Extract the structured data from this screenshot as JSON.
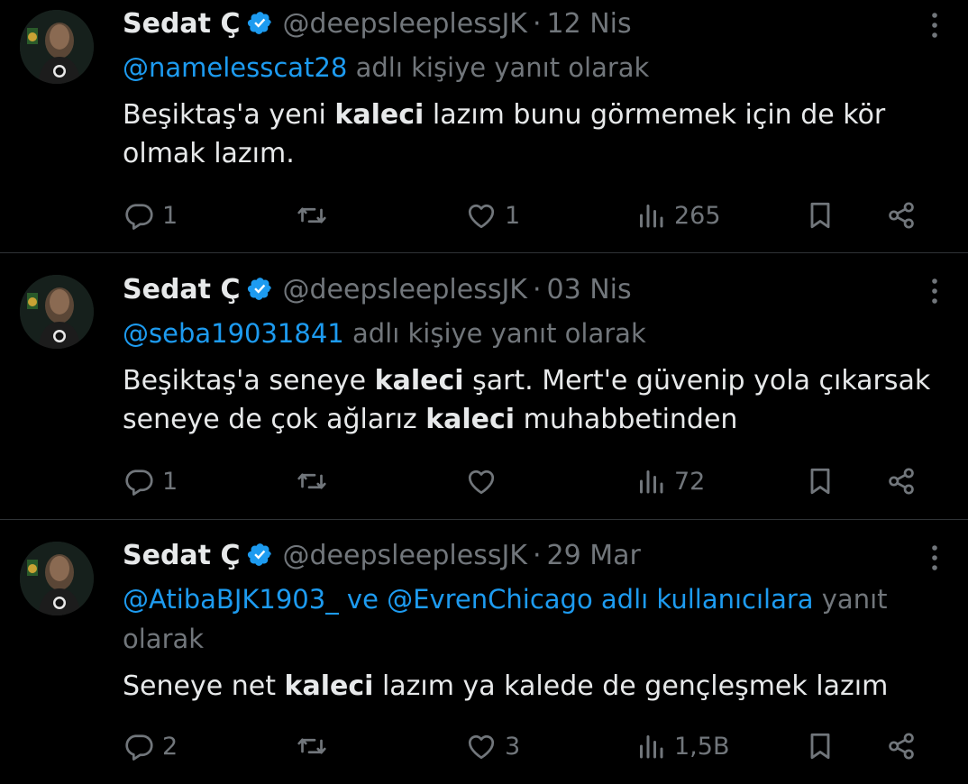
{
  "theme": {
    "background": "#000000",
    "text": "#e7e9ea",
    "muted": "#71767b",
    "accent": "#1d9bf0",
    "divider": "#2f3336"
  },
  "icons": {
    "verified": "verified-badge-icon",
    "more": "more-vertical-icon",
    "reply": "reply-icon",
    "retweet": "retweet-icon",
    "like": "heart-icon",
    "views": "views-icon",
    "bookmark": "bookmark-icon",
    "share": "share-icon"
  },
  "tweets": [
    {
      "name": "Sedat Ç",
      "handle": "@deepsleeplessJK",
      "separator": "·",
      "date": "12 Nis",
      "reply_mentions": "@namelesscat28",
      "reply_suffix": "adlı kişiye yanıt olarak",
      "body_line1_a": "Beşiktaş'a yeni ",
      "body_line1_kw": "kaleci",
      "body_line1_b": " lazım bunu görmemek için de kör",
      "body_line2": "olmak lazım.",
      "replies": "1",
      "retweets": "",
      "likes": "1",
      "views": "265"
    },
    {
      "name": "Sedat Ç",
      "handle": "@deepsleeplessJK",
      "separator": "·",
      "date": "03 Nis",
      "reply_mentions": "@seba19031841",
      "reply_suffix": "adlı kişiye yanıt olarak",
      "body_line1_a": "Beşiktaş'a seneye ",
      "body_line1_kw": "kaleci",
      "body_line1_b": " şart. Mert'e güvenip yola çıkarsak",
      "body_line2_a": "seneye de çok ağlarız ",
      "body_line2_kw": "kaleci",
      "body_line2_b": " muhabbetinden",
      "replies": "1",
      "retweets": "",
      "likes": "",
      "views": "72"
    },
    {
      "name": "Sedat Ç",
      "handle": "@deepsleeplessJK",
      "separator": "·",
      "date": "29 Mar",
      "reply_mentions": "@AtibaBJK1903_ ve @EvrenChicago adlı kullanıcılara",
      "reply_suffix_line1": "yanıt",
      "reply_suffix_line2": "olarak",
      "body_line1_a": "Seneye net ",
      "body_line1_kw": "kaleci",
      "body_line1_b": " lazım ya kalede de gençleşmek lazım",
      "replies": "2",
      "retweets": "",
      "likes": "3",
      "views": "1,5B"
    }
  ]
}
